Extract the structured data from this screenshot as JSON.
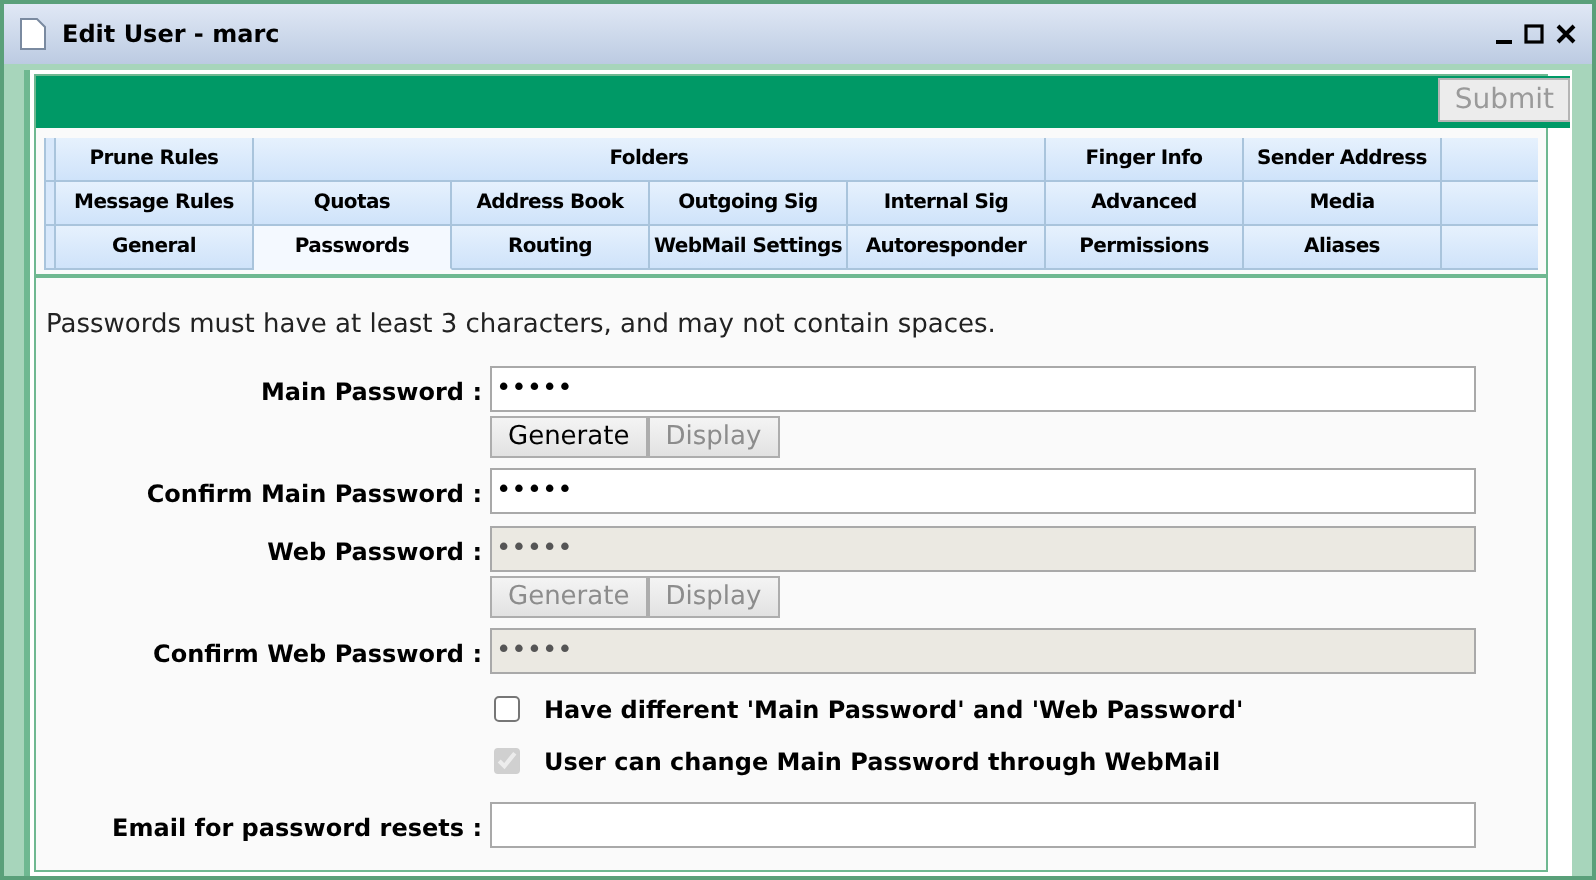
{
  "window": {
    "title": "Edit User - marc"
  },
  "submit": {
    "label": "Submit",
    "disabled": true
  },
  "tab_rows": [
    [
      {
        "label": "Prune Rules",
        "kind": "normal",
        "selected": false
      },
      {
        "label": "Folders",
        "kind": "wide",
        "selected": false
      },
      {
        "label": "Finger Info",
        "kind": "normal",
        "selected": false
      },
      {
        "label": "Sender Address",
        "kind": "normal",
        "selected": false
      }
    ],
    [
      {
        "label": "Message Rules",
        "kind": "normal",
        "selected": false
      },
      {
        "label": "Quotas",
        "kind": "normal",
        "selected": false
      },
      {
        "label": "Address Book",
        "kind": "normal",
        "selected": false
      },
      {
        "label": "Outgoing Sig",
        "kind": "normal",
        "selected": false
      },
      {
        "label": "Internal Sig",
        "kind": "normal",
        "selected": false
      },
      {
        "label": "Advanced",
        "kind": "normal",
        "selected": false
      },
      {
        "label": "Media",
        "kind": "normal",
        "selected": false
      }
    ],
    [
      {
        "label": "General",
        "kind": "normal",
        "selected": false
      },
      {
        "label": "Passwords",
        "kind": "normal",
        "selected": true
      },
      {
        "label": "Routing",
        "kind": "normal",
        "selected": false
      },
      {
        "label": "WebMail Settings",
        "kind": "normal",
        "selected": false
      },
      {
        "label": "Autoresponder",
        "kind": "normal",
        "selected": false
      },
      {
        "label": "Permissions",
        "kind": "normal",
        "selected": false
      },
      {
        "label": "Aliases",
        "kind": "normal",
        "selected": false
      }
    ]
  ],
  "note": "Passwords must have at least 3 characters, and may not contain spaces.",
  "form": [
    {
      "kind": "field",
      "label": "Main Password :",
      "value": "•••••",
      "disabled": false
    },
    {
      "kind": "buttons",
      "buttons": [
        {
          "label": "Generate",
          "disabled": false
        },
        {
          "label": "Display",
          "disabled": true
        }
      ]
    },
    {
      "kind": "field",
      "label": "Confirm Main Password :",
      "value": "•••••",
      "disabled": false
    },
    {
      "kind": "field",
      "label": "Web Password :",
      "value": "•••••",
      "disabled": true
    },
    {
      "kind": "buttons",
      "buttons": [
        {
          "label": "Generate",
          "disabled": true
        },
        {
          "label": "Display",
          "disabled": true
        }
      ]
    },
    {
      "kind": "field",
      "label": "Confirm Web Password :",
      "value": "•••••",
      "disabled": true
    },
    {
      "kind": "checkbox",
      "label": "Have different 'Main Password' and 'Web Password'",
      "checked": false,
      "disabled": false
    },
    {
      "kind": "checkbox",
      "label": "User can change Main Password through WebMail",
      "checked": true,
      "disabled": true
    },
    {
      "kind": "field",
      "label": "Email for password resets :",
      "disabled": false
    }
  ]
}
